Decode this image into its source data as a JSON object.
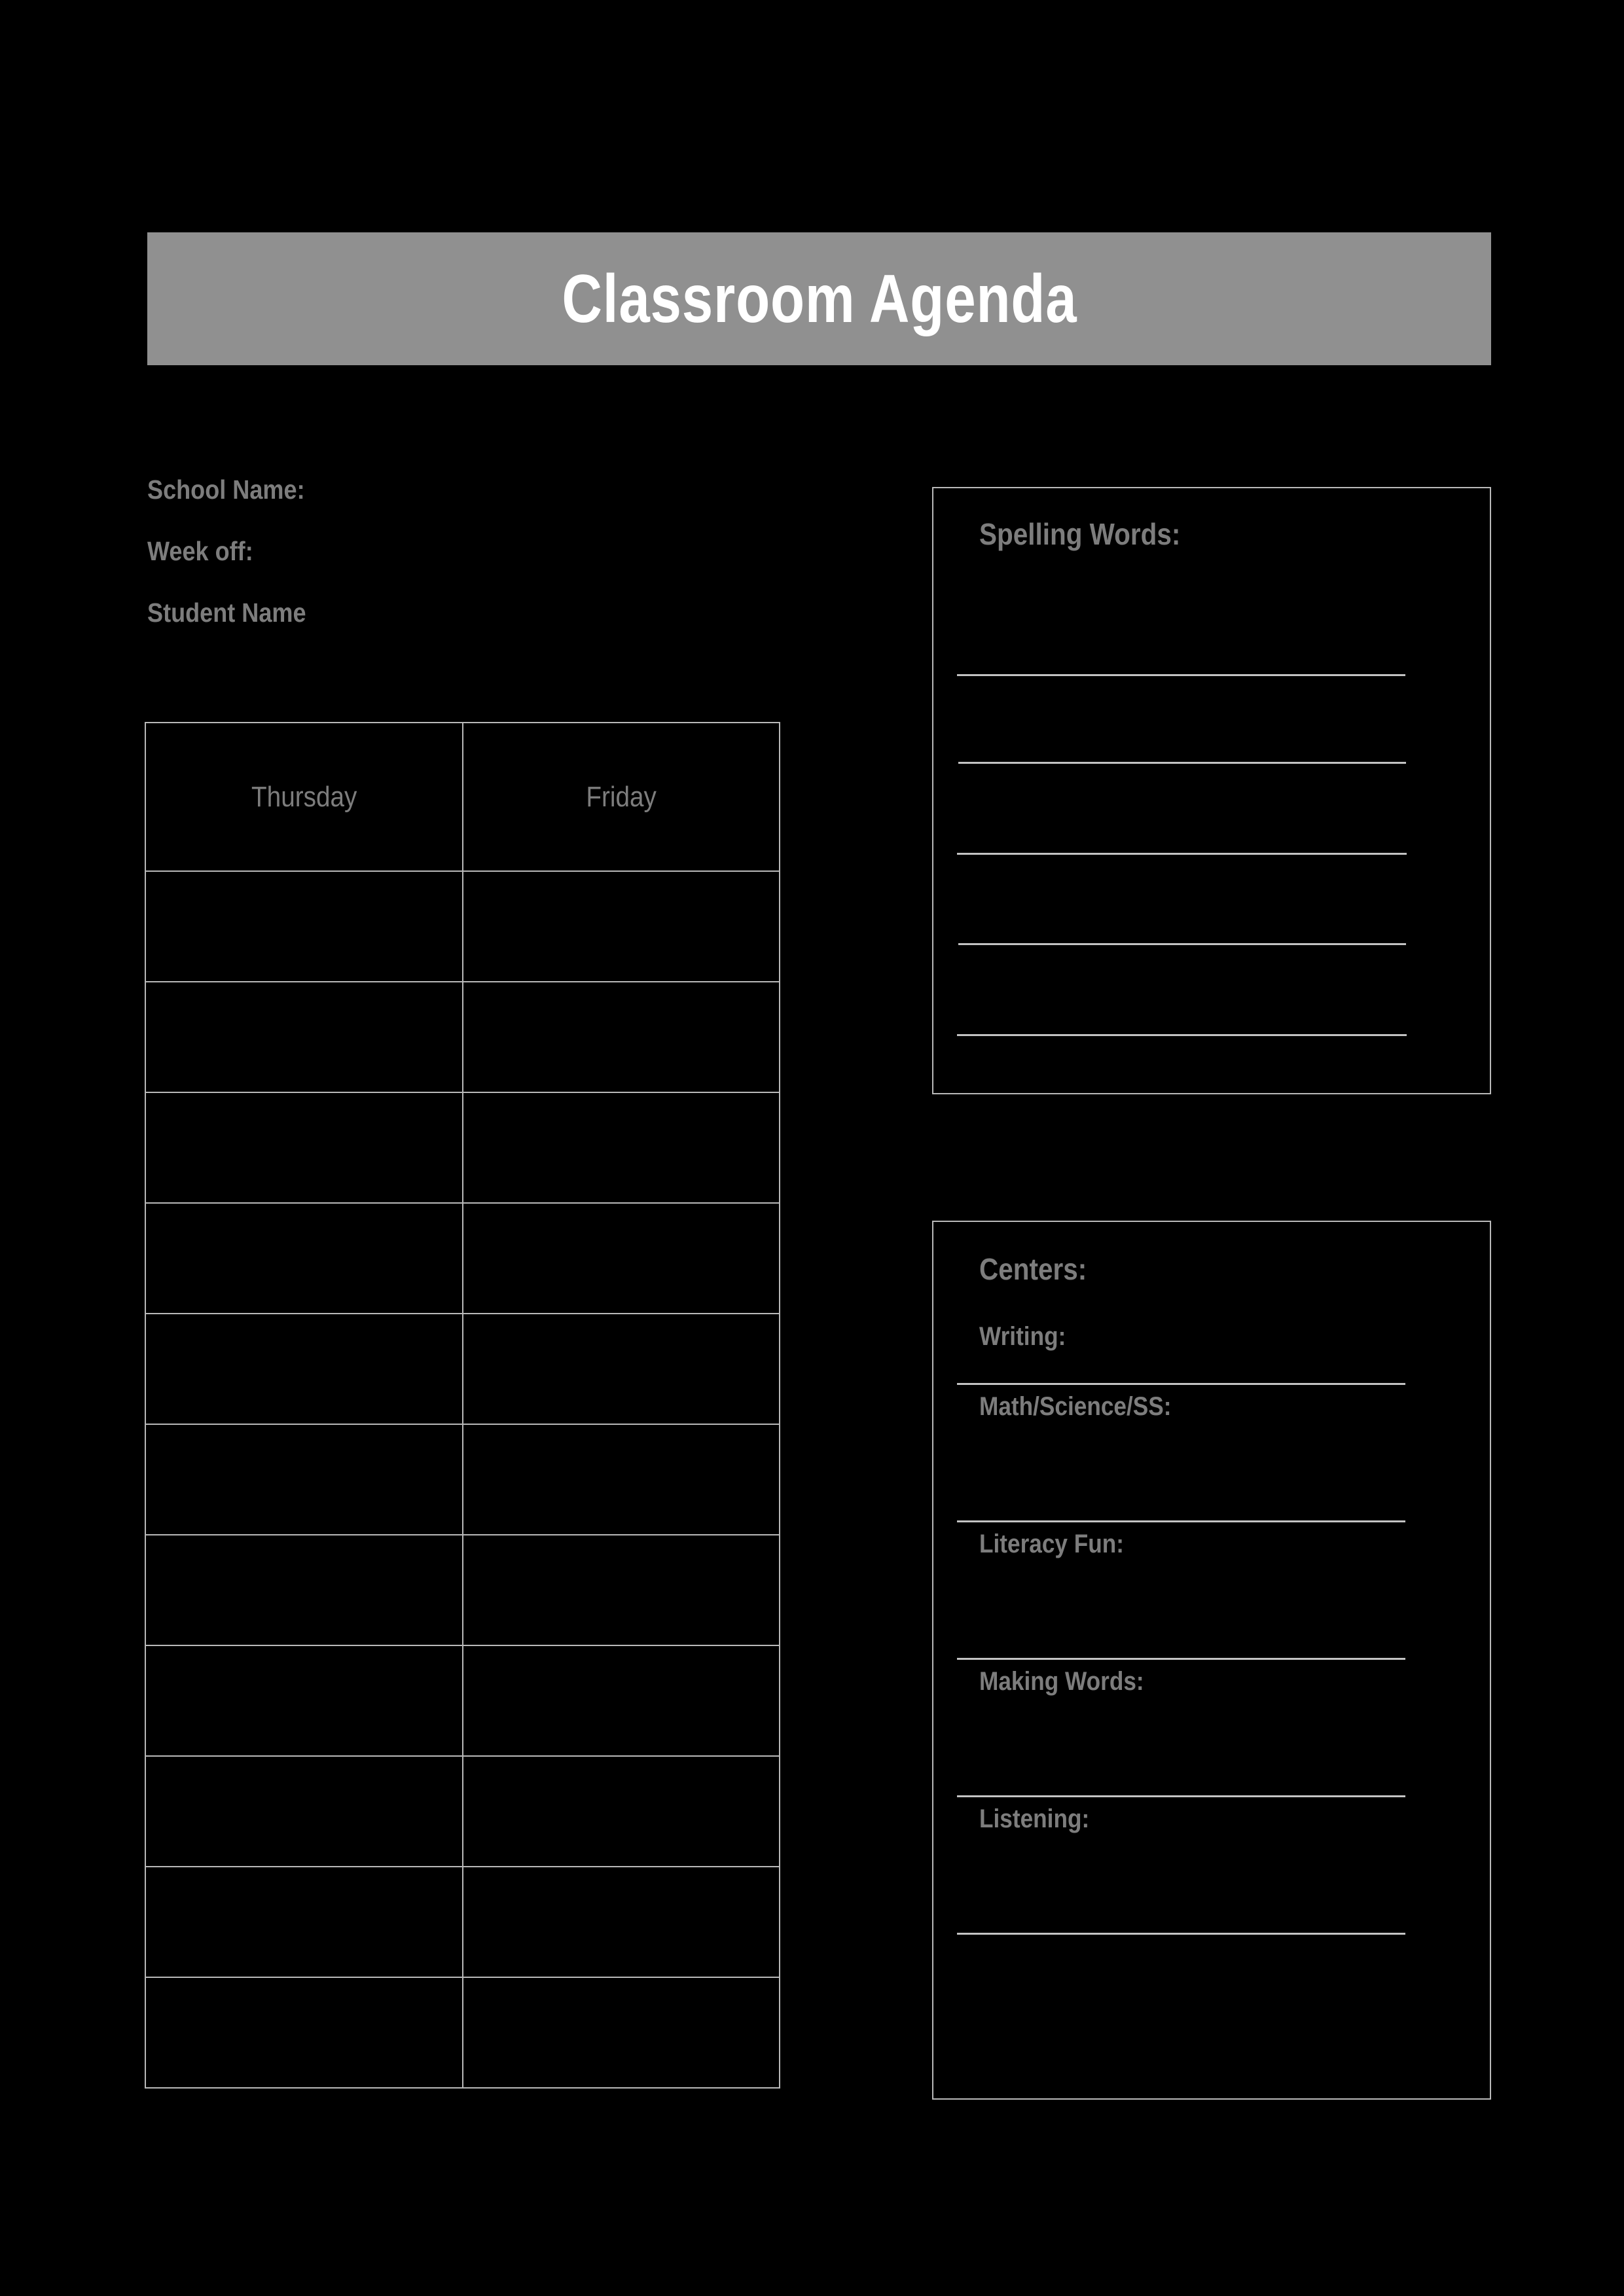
{
  "document": {
    "title": "Classroom Agenda",
    "background_color": "#000000",
    "banner_color": "#909090",
    "title_color": "#ffffff",
    "text_color": "#7d7d7d",
    "rule_color": "#c3c3c3",
    "border_color": "#b9b9b9"
  },
  "header": {
    "title": "Classroom Agenda"
  },
  "info": {
    "lines": [
      {
        "label": "School Name:"
      },
      {
        "label": "Week off:"
      },
      {
        "label": "Student Name"
      }
    ]
  },
  "agenda_table": {
    "columns": [
      "Thursday",
      "Friday"
    ],
    "row_count": 11,
    "rows": [
      [
        "",
        ""
      ],
      [
        "",
        ""
      ],
      [
        "",
        ""
      ],
      [
        "",
        ""
      ],
      [
        "",
        ""
      ],
      [
        "",
        ""
      ],
      [
        "",
        ""
      ],
      [
        "",
        ""
      ],
      [
        "",
        ""
      ],
      [
        "",
        ""
      ],
      [
        "",
        ""
      ]
    ]
  },
  "spelling_words": {
    "heading": "Spelling Words:",
    "lines": [
      {
        "value": ""
      },
      {
        "value": ""
      },
      {
        "value": ""
      },
      {
        "value": ""
      },
      {
        "value": ""
      }
    ]
  },
  "centers": {
    "heading": "Centers:",
    "items": [
      {
        "label": "Writing:",
        "value": ""
      },
      {
        "label": "Math/Science/SS:",
        "value": ""
      },
      {
        "label": "Literacy Fun:",
        "value": ""
      },
      {
        "label": "Making Words:",
        "value": ""
      },
      {
        "label": "Listening:",
        "value": ""
      }
    ]
  }
}
